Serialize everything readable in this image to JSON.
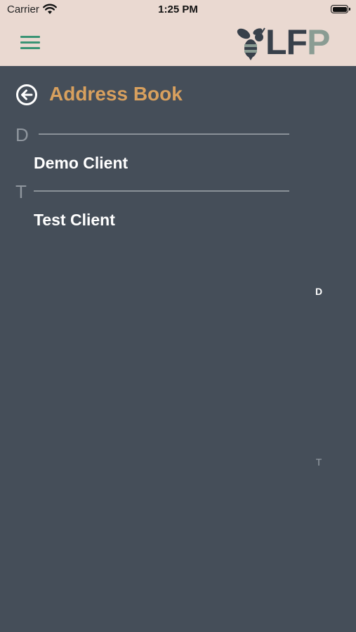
{
  "status_bar": {
    "carrier": "Carrier",
    "time": "1:25 PM"
  },
  "header": {
    "logo_text_l": "L",
    "logo_text_f": "F",
    "logo_text_p": "P"
  },
  "page": {
    "title": "Address Book"
  },
  "sections": [
    {
      "letter": "D",
      "contacts": [
        "Demo Client"
      ]
    },
    {
      "letter": "T",
      "contacts": [
        "Test Client"
      ]
    }
  ],
  "index": [
    "D",
    "T"
  ],
  "colors": {
    "header_bg": "#ead9d1",
    "body_bg": "#454e59",
    "title": "#d8a05e",
    "menu_icon": "#3a9474"
  }
}
